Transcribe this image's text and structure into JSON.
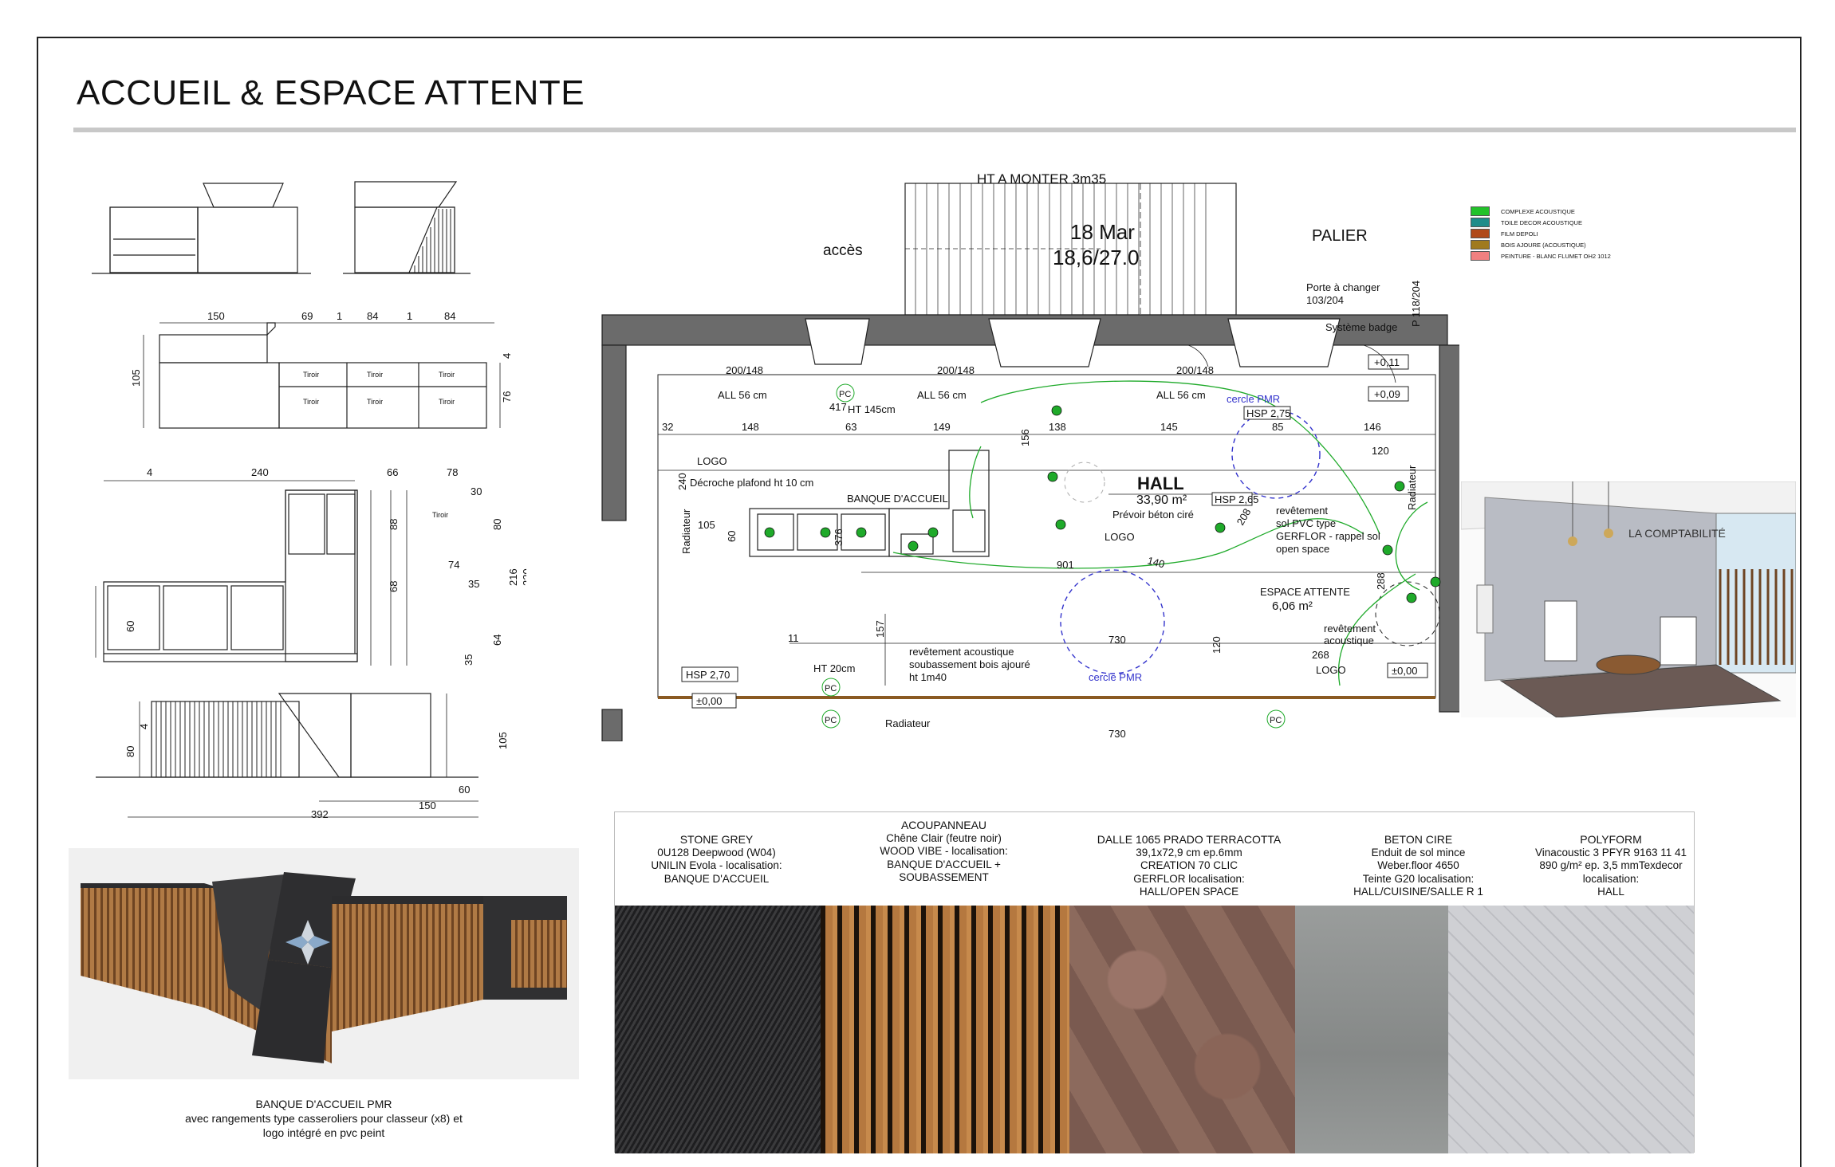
{
  "title": "ACCUEIL & ESPACE ATTENTE",
  "legend": [
    {
      "label": "COMPLEXE ACOUSTIQUE",
      "color": "#22c22a"
    },
    {
      "label": "TOILE DECOR ACOUSTIQUE",
      "color": "#1e8c8a"
    },
    {
      "label": "FILM DEPOLI",
      "color": "#b04a1a"
    },
    {
      "label": "BOIS AJOURE (ACOUSTIQUE)",
      "color": "#a07a1e"
    },
    {
      "label": "PEINTURE - BLANC FLUMET OH2 1012",
      "color": "#f08080"
    }
  ],
  "elevations": {
    "top_dims": [
      "150",
      "69",
      "1",
      "84",
      "1",
      "84"
    ],
    "front_height": "105",
    "front_right": "76",
    "front_right_small": "4",
    "drawer_label": "Tiroir",
    "plan_dims_top": [
      "4",
      "240",
      "66",
      "78"
    ],
    "plan_dims_right": [
      "30",
      "88",
      "80",
      "216",
      "220",
      "68",
      "74",
      "35",
      "60",
      "64",
      "35"
    ],
    "section_dims": [
      "80",
      "4",
      "105",
      "60",
      "150",
      "392"
    ]
  },
  "plan": {
    "stairs_label": "HT A MONTER 3m35",
    "stamp_date": "18 Mar",
    "stamp_ratio": "18,6/27.0",
    "acces": "accès",
    "palier": "PALIER",
    "porte": "Porte à changer",
    "porte_dim": "103/204",
    "p_dim": "P 118/204",
    "badge": "Système badge",
    "lvl_011": "+0,11",
    "lvl_009": "+0,09",
    "window_dims": [
      "200/148",
      "200/148",
      "200/148"
    ],
    "all56": "ALL 56 cm",
    "pc": "PC",
    "ht145": "HT 145cm",
    "dim_417": "417",
    "cercle_pmr": "cercle PMR",
    "hsp275": "HSP 2,75",
    "hsp265": "HSP 2,65",
    "hsp270": "HSP 2,70",
    "row_dims": [
      "32",
      "148",
      "63",
      "149",
      "138",
      "145",
      "85",
      "146"
    ],
    "logo": "LOGO",
    "decroche": "Décroche plafond ht 10 cm",
    "banque": "BANQUE D'ACCUEIL",
    "hall": "HALL",
    "hall_area": "33,90 m²",
    "beton": "Prévoir béton ciré",
    "revetement_sol": [
      "revêtement",
      "sol PVC type",
      "GERFLOR - rappel sol",
      "open space"
    ],
    "espace_attente": "ESPACE ATTENTE",
    "espace_area": "6,06 m²",
    "revetement_acoustique": [
      "revêtement",
      "acoustique"
    ],
    "dim_268": "268",
    "radiateur": "Radiateur",
    "dims_misc": [
      "120",
      "156",
      "240",
      "105",
      "60",
      "376",
      "901",
      "140",
      "208",
      "288",
      "11",
      "157",
      "730",
      "120"
    ],
    "soubassement": [
      "revêtement acoustique",
      "soubassement bois ajouré",
      "ht 1m40"
    ],
    "ht20": "HT 20cm",
    "zero": "±0,00"
  },
  "caption": [
    "BANQUE D'ACCUEIL PMR",
    "avec rangements type casseroliers pour classeur (x8) et",
    "logo intégré en pvc peint"
  ],
  "sketch_label": "LA COMPTABILITÉ",
  "materials": [
    {
      "lines": [
        "STONE GREY",
        "0U128 Deepwood (W04)",
        "UNILIN Evola - localisation:",
        "BANQUE D'ACCUEIL"
      ],
      "color": "#2a2a2c"
    },
    {
      "lines": [
        "ACOUPANNEAU",
        "Chêne Clair (feutre noir)",
        "WOOD VIBE - localisation:",
        "BANQUE D'ACCUEIL +",
        "SOUBASSEMENT"
      ],
      "color": "#a26a3c"
    },
    {
      "lines": [
        "DALLE 1065 PRADO TERRACOTTA",
        "39,1x72,9 cm ep.6mm",
        "CREATION 70 CLIC",
        "GERFLOR localisation:",
        "HALL/OPEN SPACE"
      ],
      "color": "#7e5e52"
    },
    {
      "lines": [
        "BETON CIRE",
        "Enduit de sol mince",
        "Weber.floor 4650",
        "Teinte G20 localisation:",
        "HALL/CUISINE/SALLE R 1"
      ],
      "color": "#8f9291"
    },
    {
      "lines": [
        "POLYFORM",
        "Vinacoustic 3 PFYR 9163  11 41",
        "890 g/m² ep. 3,5 mmTexdecor",
        "localisation:",
        "HALL"
      ],
      "color": "#c9cace"
    }
  ]
}
